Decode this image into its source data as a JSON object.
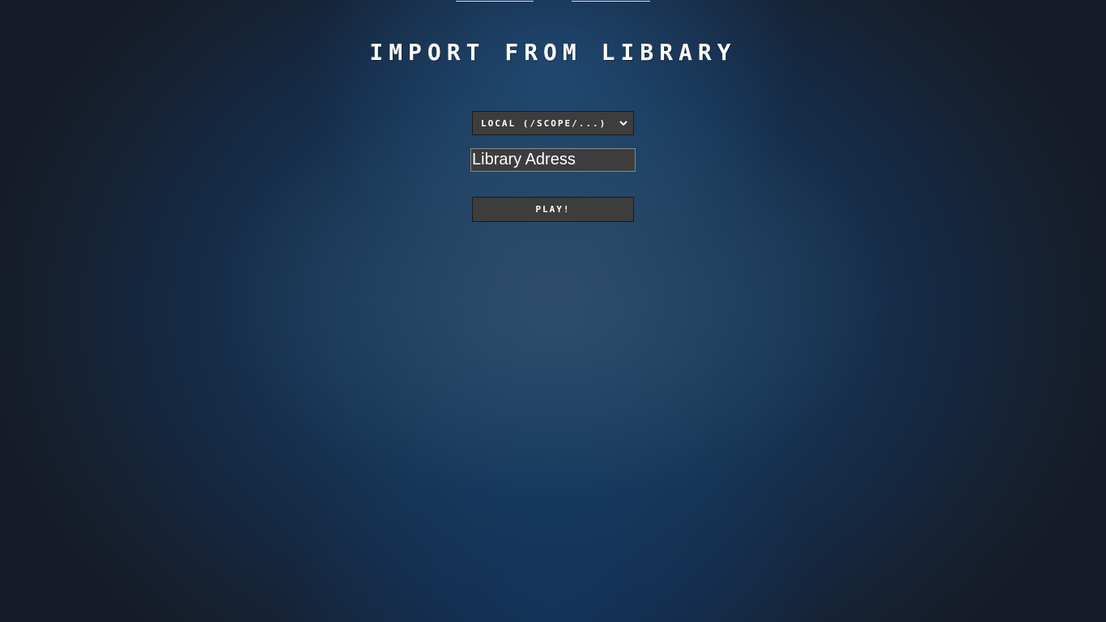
{
  "page": {
    "title": "IMPORT FROM LIBRARY"
  },
  "source_select": {
    "selected": "LOCAL (/SCOPE/...)"
  },
  "library_address": {
    "value": "",
    "placeholder": "Library Adress"
  },
  "play_button": {
    "label": "PLAY!"
  },
  "icons": {
    "select_arrow": "chevron-down-icon"
  },
  "colors": {
    "control_bg": "#3d3d3d",
    "text": "#ffffff",
    "background_center": "#1f4a73",
    "background_edge": "#161c27"
  }
}
